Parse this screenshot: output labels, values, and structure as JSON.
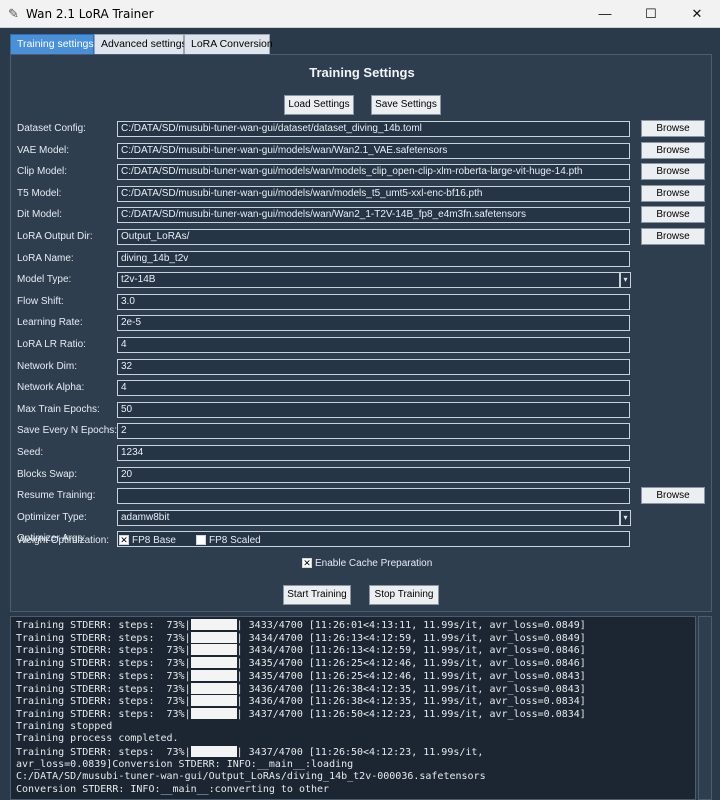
{
  "window": {
    "title": "Wan 2.1 LoRA Trainer",
    "min": "—",
    "max": "☐",
    "close": "✕",
    "icon": "feather-icon"
  },
  "tabs": [
    "Training settings",
    "Advanced settings",
    "LoRA Conversion"
  ],
  "panel": {
    "title": "Training Settings",
    "load_label": "Load Settings",
    "save_label": "Save Settings",
    "browse_label": "Browse",
    "fields": [
      {
        "label": "Dataset Config:",
        "value": "C:/DATA/SD/musubi-tuner-wan-gui/dataset/dataset_diving_14b.toml",
        "browse": true
      },
      {
        "label": "VAE Model:",
        "value": "C:/DATA/SD/musubi-tuner-wan-gui/models/wan/Wan2.1_VAE.safetensors",
        "browse": true
      },
      {
        "label": "Clip Model:",
        "value": "C:/DATA/SD/musubi-tuner-wan-gui/models/wan/models_clip_open-clip-xlm-roberta-large-vit-huge-14.pth",
        "browse": true
      },
      {
        "label": "T5 Model:",
        "value": "C:/DATA/SD/musubi-tuner-wan-gui/models/wan/models_t5_umt5-xxl-enc-bf16.pth",
        "browse": true
      },
      {
        "label": "Dit Model:",
        "value": "C:/DATA/SD/musubi-tuner-wan-gui/models/wan/Wan2_1-T2V-14B_fp8_e4m3fn.safetensors",
        "browse": true
      },
      {
        "label": "LoRA Output Dir:",
        "value": "Output_LoRAs/",
        "browse": true
      },
      {
        "label": "LoRA Name:",
        "value": "diving_14b_t2v"
      },
      {
        "label": "Model Type:",
        "value": "t2v-14B",
        "dropdown": true
      },
      {
        "label": "Flow Shift:",
        "value": "3.0"
      },
      {
        "label": "Learning Rate:",
        "value": "2e-5"
      },
      {
        "label": "LoRA LR Ratio:",
        "value": "4"
      },
      {
        "label": "Network Dim:",
        "value": "32"
      },
      {
        "label": "Network Alpha:",
        "value": "4"
      },
      {
        "label": "Max Train Epochs:",
        "value": "50"
      },
      {
        "label": "Save Every N Epochs:",
        "value": "2"
      },
      {
        "label": "Seed:",
        "value": "1234"
      },
      {
        "label": "Blocks Swap:",
        "value": "20"
      },
      {
        "label": "Resume Training:",
        "value": "",
        "browse": true
      },
      {
        "label": "Optimizer Type:",
        "value": "adamw8bit",
        "dropdown": true
      },
      {
        "label": "Optimizer Args:",
        "value": ""
      }
    ],
    "weight_opt_label": "Weight Optimization:",
    "fp8_base_label": "FP8 Base",
    "fp8_base_checked": true,
    "fp8_scaled_label": "FP8 Scaled",
    "fp8_scaled_checked": false,
    "cache_label": "Enable Cache Preparation",
    "cache_checked": true,
    "start_label": "Start Training",
    "stop_label": "Stop Training"
  },
  "console": {
    "lines": [
      {
        "pre": "Training STDERR: steps:  73%|",
        "bar": true,
        "post": "| 3433/4700 [11:26:01<4:13:11, 11.99s/it, avr_loss=0.0849]"
      },
      {
        "pre": "Training STDERR: steps:  73%|",
        "bar": true,
        "post": "| 3434/4700 [11:26:13<4:12:59, 11.99s/it, avr_loss=0.0849]"
      },
      {
        "pre": "Training STDERR: steps:  73%|",
        "bar": true,
        "post": "| 3434/4700 [11:26:13<4:12:59, 11.99s/it, avr_loss=0.0846]"
      },
      {
        "pre": "Training STDERR: steps:  73%|",
        "bar": true,
        "post": "| 3435/4700 [11:26:25<4:12:46, 11.99s/it, avr_loss=0.0846]"
      },
      {
        "pre": "Training STDERR: steps:  73%|",
        "bar": true,
        "post": "| 3435/4700 [11:26:25<4:12:46, 11.99s/it, avr_loss=0.0843]"
      },
      {
        "pre": "Training STDERR: steps:  73%|",
        "bar": true,
        "post": "| 3436/4700 [11:26:38<4:12:35, 11.99s/it, avr_loss=0.0843]"
      },
      {
        "pre": "Training STDERR: steps:  73%|",
        "bar": true,
        "post": "| 3436/4700 [11:26:38<4:12:35, 11.99s/it, avr_loss=0.0834]"
      },
      {
        "pre": "Training STDERR: steps:  73%|",
        "bar": true,
        "post": "| 3437/4700 [11:26:50<4:12:23, 11.99s/it, avr_loss=0.0834]"
      },
      {
        "pre": "Training stopped",
        "bar": false,
        "post": ""
      },
      {
        "pre": "Training process completed.",
        "bar": false,
        "post": ""
      },
      {
        "pre": "Training STDERR: steps:  73%|",
        "bar": true,
        "post": "| 3437/4700 [11:26:50<4:12:23, 11.99s/it,"
      },
      {
        "pre": "avr_loss=0.0839]Conversion STDERR: INFO:__main__:loading",
        "bar": false,
        "post": ""
      },
      {
        "pre": "C:/DATA/SD/musubi-tuner-wan-gui/Output_LoRAs/diving_14b_t2v-000036.safetensors",
        "bar": false,
        "post": ""
      },
      {
        "pre": "Conversion STDERR: INFO:__main__:converting to other",
        "bar": false,
        "post": ""
      }
    ]
  }
}
